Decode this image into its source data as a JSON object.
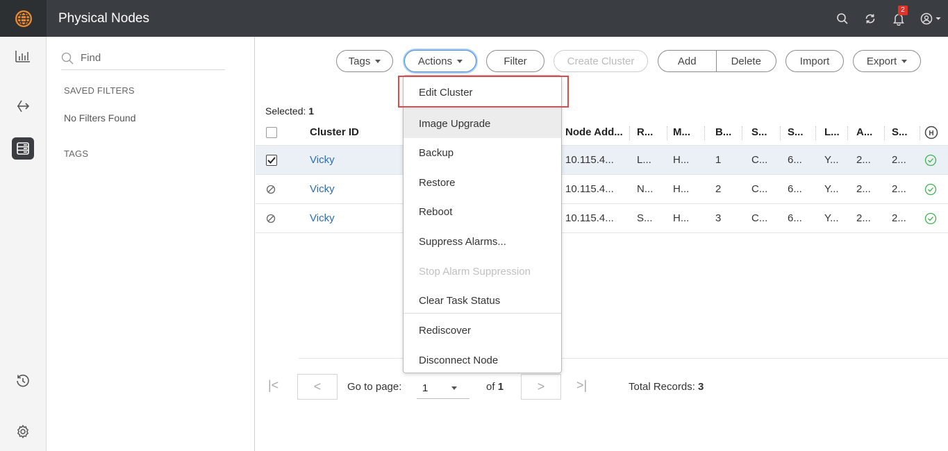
{
  "header": {
    "title": "Physical Nodes",
    "notification_count": "2",
    "icons": [
      "globe-icon",
      "search-icon",
      "refresh-icon",
      "bell-icon",
      "user-icon"
    ]
  },
  "filters": {
    "find_placeholder": "Find",
    "saved_filters_label": "SAVED FILTERS",
    "no_filters_text": "No Filters Found",
    "tags_label": "TAGS"
  },
  "toolbar": {
    "tags": "Tags",
    "actions": "Actions",
    "filter": "Filter",
    "create_cluster": "Create Cluster",
    "add": "Add",
    "delete": "Delete",
    "import": "Import",
    "export": "Export"
  },
  "table": {
    "selected_label": "Selected: ",
    "selected_count": "1",
    "columns": [
      "Cluster ID",
      "Node Add...",
      "R...",
      "M...",
      "B...",
      "S...",
      "S...",
      "L...",
      "A...",
      "S..."
    ],
    "rows": [
      {
        "checked": true,
        "cluster_id": "Vicky",
        "node_address": "10.115.4...",
        "c3": "L...",
        "c4": "H...",
        "c5": "1",
        "c6": "C...",
        "c7": "6...",
        "c8": "Y...",
        "c9": "2...",
        "c10": "2..."
      },
      {
        "checked": false,
        "cluster_id": "Vicky",
        "node_address": "10.115.4...",
        "c3": "N...",
        "c4": "H...",
        "c5": "2",
        "c6": "C...",
        "c7": "6...",
        "c8": "Y...",
        "c9": "2...",
        "c10": "2..."
      },
      {
        "checked": false,
        "cluster_id": "Vicky",
        "node_address": "10.115.4...",
        "c3": "S...",
        "c4": "H...",
        "c5": "3",
        "c6": "C...",
        "c7": "6...",
        "c8": "Y...",
        "c9": "2...",
        "c10": "2..."
      }
    ]
  },
  "actions_menu": {
    "items": [
      {
        "label": "Edit Cluster",
        "enabled": true
      },
      {
        "label": "Image Upgrade",
        "enabled": true
      },
      {
        "label": "Backup",
        "enabled": true
      },
      {
        "label": "Restore",
        "enabled": true
      },
      {
        "label": "Reboot",
        "enabled": true
      },
      {
        "label": "Suppress Alarms...",
        "enabled": true
      },
      {
        "label": "Stop Alarm Suppression",
        "enabled": false
      },
      {
        "label": "Clear Task Status",
        "enabled": true
      },
      {
        "label": "Rediscover",
        "enabled": true
      },
      {
        "label": "Disconnect Node",
        "enabled": true
      }
    ]
  },
  "pagination": {
    "go_to_page_label": "Go to page:",
    "current_page": "1",
    "of_label": "of ",
    "total_pages": "1",
    "total_records_label": "Total Records: ",
    "total_records": "3"
  },
  "colors": {
    "header_bg": "#3a3d41",
    "link": "#2a6db3",
    "status_ok": "#3bb34a",
    "highlight": "#e0484a",
    "badge": "#e0342b"
  }
}
